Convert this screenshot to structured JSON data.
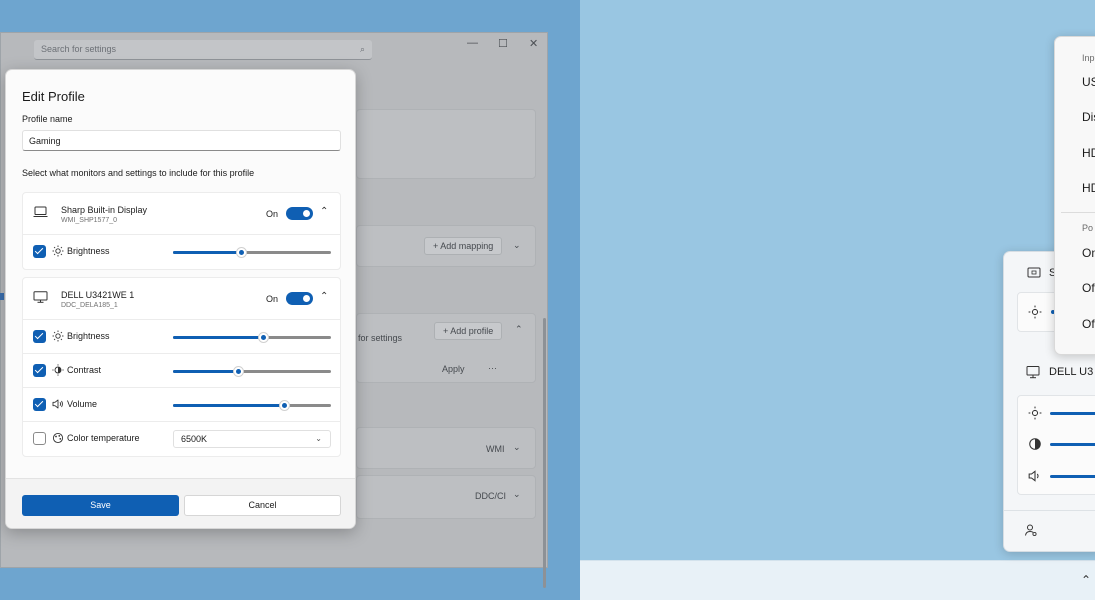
{
  "settings_window": {
    "search_placeholder": "Search for settings",
    "controls": {
      "minimize": "—",
      "maximize": "☐",
      "close": "✕"
    },
    "add_mapping": "+ Add mapping",
    "for_settings": "for settings",
    "add_profile": "+ Add profile",
    "apply": "Apply",
    "more": "···",
    "wmi_label": "WMI",
    "ddc_label": "DDC/CI"
  },
  "dialog": {
    "title": "Edit Profile",
    "profile_name_label": "Profile name",
    "profile_name_value": "Gaming",
    "section_label": "Select what monitors and settings to include for this profile",
    "monitors": [
      {
        "name": "Sharp Built-in Display",
        "id": "WMI_SHP1577_0",
        "state": "On",
        "icon": "laptop-icon",
        "settings": [
          {
            "label": "Brightness",
            "checked": true,
            "level": 0.43,
            "icon": "sun-icon"
          }
        ]
      },
      {
        "name": "DELL U3421WE 1",
        "id": "DDC_DELA185_1",
        "state": "On",
        "icon": "monitor-icon",
        "settings": [
          {
            "label": "Brightness",
            "checked": true,
            "level": 0.57,
            "icon": "sun-icon"
          },
          {
            "label": "Contrast",
            "checked": true,
            "level": 0.41,
            "icon": "contrast-icon"
          },
          {
            "label": "Volume",
            "checked": true,
            "level": 0.7,
            "icon": "volume-icon"
          },
          {
            "label": "Color temperature",
            "checked": false,
            "select_value": "6500K",
            "icon": "color-temperature-icon"
          }
        ]
      }
    ],
    "save": "Save",
    "cancel": "Cancel"
  },
  "flyout": {
    "sharp_fragment": "S",
    "dell_fragment": "DELL U3"
  },
  "menu": {
    "input_header": "Inp",
    "items_input": [
      "US",
      "Dis",
      "HD",
      "HD"
    ],
    "power_header": "Po",
    "items_power": [
      "On",
      "Of",
      "Of"
    ]
  },
  "colors": {
    "accent": "#0f5fb3",
    "desktop_left": "#6ea5cf",
    "desktop_right": "#99c6e2"
  }
}
